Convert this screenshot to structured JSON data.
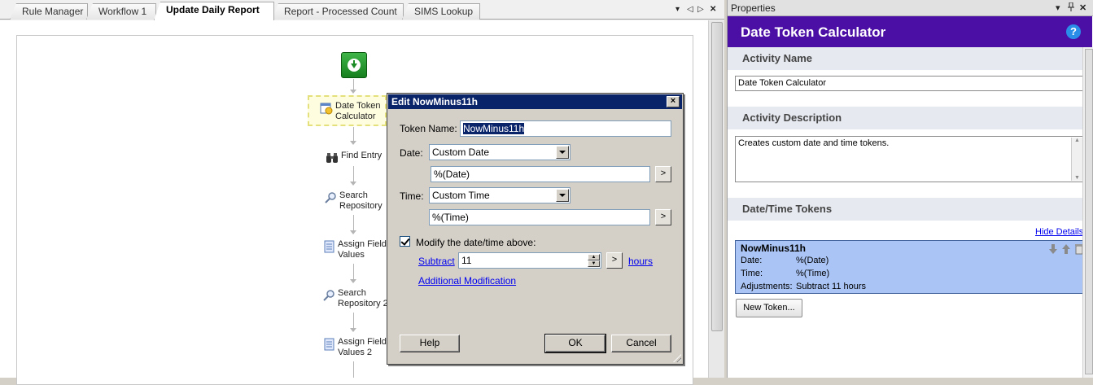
{
  "tabs": [
    {
      "label": "Rule Manager",
      "active": false
    },
    {
      "label": "Workflow 1",
      "active": false
    },
    {
      "label": "Update Daily Report",
      "active": true
    },
    {
      "label": "Report - Processed Count",
      "active": false
    },
    {
      "label": "SIMS Lookup",
      "active": false
    }
  ],
  "tab_controls": {
    "dropdown": "▾",
    "prev": "◁",
    "next": "▷",
    "close": "✕"
  },
  "workflow": {
    "nodes": [
      {
        "line1": "Date Token",
        "line2": "Calculator",
        "icon": "date-token-icon"
      },
      {
        "line1": "Find Entry",
        "line2": "",
        "icon": "binoculars-icon"
      },
      {
        "line1": "Search",
        "line2": "Repository",
        "icon": "magnifier-icon"
      },
      {
        "line1": "Assign Field",
        "line2": "Values",
        "icon": "document-icon"
      },
      {
        "line1": "Search",
        "line2": "Repository 2",
        "icon": "magnifier-icon"
      },
      {
        "line1": "Assign Field",
        "line2": "Values 2",
        "icon": "document-icon"
      }
    ]
  },
  "dialog": {
    "title": "Edit NowMinus11h",
    "close_glyph": "×",
    "token_name_label": "Token Name:",
    "token_name_value": "NowMinus11h",
    "date_label": "Date:",
    "date_select": "Custom Date",
    "date_expr": "%(Date)",
    "time_label": "Time:",
    "time_select": "Custom Time",
    "time_expr": "%(Time)",
    "expr_button": ">",
    "modify_label": "Modify the date/time above:",
    "modify_checked": true,
    "operation_link": "Subtract",
    "amount": "11",
    "unit_link": "hours",
    "additional_link": "Additional Modification",
    "help_button": "Help",
    "ok_button": "OK",
    "cancel_button": "Cancel"
  },
  "properties": {
    "header": "Properties",
    "header_controls": {
      "dropdown": "▾",
      "pin": "ᵖ",
      "close": "✕"
    },
    "title": "Date Token Calculator",
    "help_glyph": "?",
    "activity_name_header": "Activity Name",
    "activity_name_value": "Date Token Calculator",
    "activity_description_header": "Activity Description",
    "activity_description_value": "Creates custom date and time tokens.",
    "tokens_header": "Date/Time Tokens",
    "hide_details_link": "Hide Details",
    "token": {
      "name": "NowMinus11h",
      "date_label": "Date:",
      "date_value": "%(Date)",
      "time_label": "Time:",
      "time_value": "%(Time)",
      "adjust_label": "Adjustments:",
      "adjust_value": "Subtract 11 hours"
    },
    "new_token_button": "New Token..."
  }
}
